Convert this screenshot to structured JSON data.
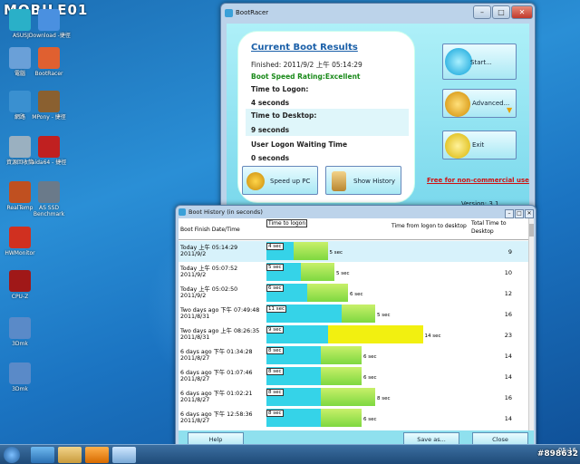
{
  "watermark": "MOBILE01",
  "watermark_id": "#898632",
  "desktop": {
    "icons": [
      {
        "label": "ASUS",
        "name": "asus-icon"
      },
      {
        "label": "JDownload\n-捷徑",
        "name": "jdownload-icon"
      },
      {
        "label": "電腦",
        "name": "computer-icon"
      },
      {
        "label": "BootRacer",
        "name": "bootracer-icon"
      },
      {
        "label": "網路",
        "name": "network-icon"
      },
      {
        "label": "MPony - 捷徑",
        "name": "mpony-icon"
      },
      {
        "label": "資源回收筒",
        "name": "recycle-bin-icon"
      },
      {
        "label": "aida64 - 捷徑",
        "name": "aida64-icon"
      },
      {
        "label": "RealTemp",
        "name": "realtemp-icon"
      },
      {
        "label": "AS SSD Benchmark",
        "name": "as-ssd-icon"
      },
      {
        "label": "HWMonitor",
        "name": "hwmonitor-icon"
      },
      {
        "label": "CPU-Z",
        "name": "cpuz-icon"
      },
      {
        "label": "3Dmk",
        "name": "app1-icon"
      },
      {
        "label": "3Dmk",
        "name": "app2-icon"
      }
    ]
  },
  "main_window": {
    "title": "BootRacer",
    "heading": "Current Boot Results",
    "finished": "Finished: 2011/9/2 上午 05:14:29",
    "rating": "Boot Speed Rating:Excellent",
    "logon_label": "Time to Logon:",
    "logon_value": "4 seconds",
    "desktop_label": "Time to Desktop:",
    "desktop_value": "9 seconds",
    "waiting_label": "User Logon Waiting Time",
    "waiting_value": "0 seconds",
    "speedup": "Speed up PC",
    "show_history": "Show History",
    "start": "Start...",
    "advanced": "Advanced...",
    "exit": "Exit",
    "free": "Free for non-commercial use",
    "version": "Version: 3.1",
    "colors": {
      "accent": "#1a5fa8",
      "rating": "#1a8a1a",
      "free": "#d01010",
      "bg": "#7ad8ec"
    }
  },
  "history": {
    "title": "Boot History (in seconds)",
    "col_date": "Boot Finish Date/Time",
    "col_logon": "Time to logon",
    "col_desk": "Time from logon to desktop",
    "col_total": "Total Time to Desktop",
    "rows": [
      {
        "d1": "Today  上午 05:14:29",
        "d2": "2011/9/2",
        "logon": 4,
        "desk": 5,
        "total": 9,
        "logon_label": "4 sec",
        "desk_label": "5 sec"
      },
      {
        "d1": "Today  上午 05:07:52",
        "d2": "2011/9/2",
        "logon": 5,
        "desk": 5,
        "total": 10,
        "logon_label": "5 sec",
        "desk_label": "5 sec"
      },
      {
        "d1": "Today  上午 05:02:50",
        "d2": "2011/9/2",
        "logon": 6,
        "desk": 6,
        "total": 12,
        "logon_label": "6 sec",
        "desk_label": "6 sec"
      },
      {
        "d1": "Two days ago  下午 07:49:48",
        "d2": "2011/8/31",
        "logon": 11,
        "desk": 5,
        "total": 16,
        "logon_label": "11 sec",
        "desk_label": "5 sec"
      },
      {
        "d1": "Two days ago  上午 08:26:35",
        "d2": "2011/8/31",
        "logon": 9,
        "desk": 14,
        "total": 23,
        "logon_label": "9 sec",
        "desk_label": "14 sec",
        "warn": true
      },
      {
        "d1": "6 days ago  下午 01:34:28",
        "d2": "2011/8/27",
        "logon": 8,
        "desk": 6,
        "total": 14,
        "logon_label": "8 sec",
        "desk_label": "6 sec"
      },
      {
        "d1": "6 days ago  下午 01:07:46",
        "d2": "2011/8/27",
        "logon": 8,
        "desk": 6,
        "total": 14,
        "logon_label": "8 sec",
        "desk_label": "6 sec"
      },
      {
        "d1": "6 days ago  下午 01:02:21",
        "d2": "2011/8/27",
        "logon": 8,
        "desk": 8,
        "total": 16,
        "logon_label": "8 sec",
        "desk_label": "8 sec"
      },
      {
        "d1": "6 days ago  下午 12:58:36",
        "d2": "2011/8/27",
        "logon": 8,
        "desk": 6,
        "total": 14,
        "logon_label": "8 sec",
        "desk_label": "6 sec"
      }
    ],
    "help": "Help",
    "save": "Save as...",
    "close": "Close"
  },
  "taskbar": {
    "clock": "05:16"
  }
}
